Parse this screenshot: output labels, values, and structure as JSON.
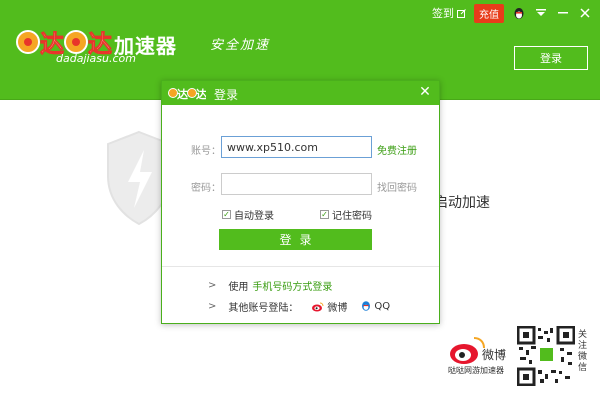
{
  "header": {
    "logo_text": "加速器",
    "logo_url": "dadajiasu.com",
    "slogan": "安全加速",
    "sign_in": "签到",
    "recharge": "充值",
    "login_button": "登录",
    "colors": {
      "brand": "#52bc1d",
      "recharge": "#e83c1a"
    }
  },
  "background": {
    "accel_text": "启动加速",
    "weibo_label": "哒哒网游加速器",
    "follow_text": "关注微信"
  },
  "dialog": {
    "title": "登录",
    "account_label": "账号：",
    "account_value": "www.xp510.com",
    "register_link": "免费注册",
    "password_label": "密码：",
    "password_value": "",
    "forgot_link": "找回密码",
    "auto_login": "自动登录",
    "remember_password": "记住密码",
    "submit": "登录",
    "phone_login_prefix": "使用",
    "phone_login_link": "手机号码方式登录",
    "other_accounts": "其他账号登陆：",
    "weibo": "微博",
    "qq": "QQ"
  }
}
